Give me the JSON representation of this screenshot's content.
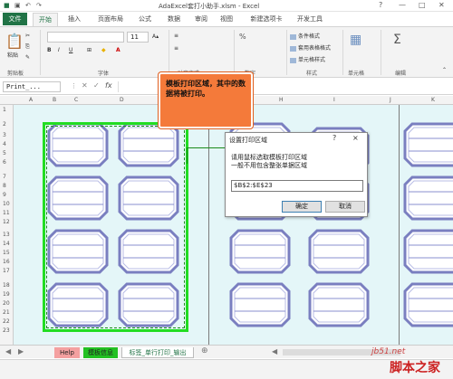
{
  "app": {
    "title": "AdaExcel套打小助手.xlsm - Excel"
  },
  "tabs": [
    {
      "label": "文件"
    },
    {
      "label": "开始"
    },
    {
      "label": "插入"
    },
    {
      "label": "页面布局"
    },
    {
      "label": "公式"
    },
    {
      "label": "数据"
    },
    {
      "label": "审阅"
    },
    {
      "label": "视图"
    },
    {
      "label": "新建选项卡"
    },
    {
      "label": "开发工具"
    }
  ],
  "ribbon": {
    "paste_label": "粘贴",
    "font_size": "11",
    "groups": [
      "剪贴板",
      "字体",
      "对齐方式",
      "数字",
      "样式",
      "单元格",
      "编辑"
    ],
    "styles": [
      "条件格式",
      "套用表格格式",
      "单元格样式"
    ]
  },
  "formula_bar": {
    "name_box": "Print_...",
    "fx": "fx"
  },
  "columns": [
    "A",
    "B",
    "C",
    "D",
    "E",
    "F",
    "G",
    "H",
    "I",
    "J",
    "K"
  ],
  "rows": [
    "1",
    "2",
    "3",
    "4",
    "5",
    "6",
    "7",
    "8",
    "9",
    "10",
    "11",
    "12",
    "13",
    "14",
    "15",
    "16",
    "17",
    "18",
    "19",
    "20",
    "21",
    "22",
    "23"
  ],
  "callout": {
    "text": "模板打印区域，其中的数据将被打印。"
  },
  "dialog": {
    "title": "设置打印区域",
    "help": "?",
    "close": "×",
    "message1": "请用鼠标选取模板打印区域",
    "message2": "一般不用包含整张单据区域",
    "range_value": "$B$2:$E$23",
    "ok_label": "确定",
    "cancel_label": "取消"
  },
  "sheet_tabs": [
    {
      "label": "Help",
      "color": "#f4a0a0"
    },
    {
      "label": "模板信息",
      "color": "#22c122"
    },
    {
      "label": "标签_单行打印_输出",
      "color": "#ffffff"
    }
  ],
  "sheet_add": "⊕",
  "watermark": {
    "line1": "jb51.net",
    "line2": "脚本之家"
  }
}
